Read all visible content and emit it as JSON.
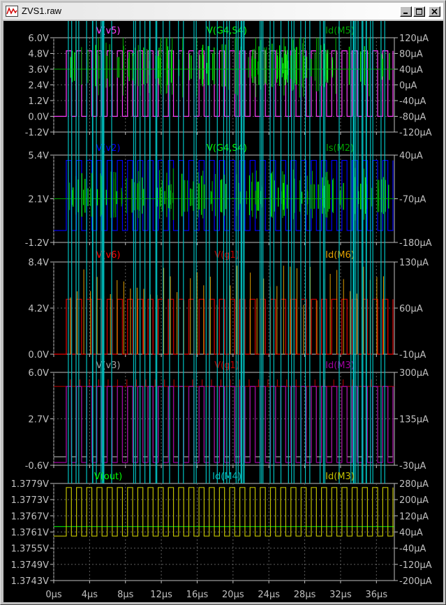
{
  "window": {
    "title": "ZVS1.raw",
    "buttons": {
      "minimize": "minimize-icon",
      "maximize": "maximize-icon",
      "close": "close-icon"
    }
  },
  "colors": {
    "background": "#000000",
    "grid": "#606060",
    "axis_text": "#c0c0c0",
    "magenta": "#ff40ff",
    "green": "#00ff00",
    "dark_green": "#00a000",
    "blue": "#0000ff",
    "red": "#ff0000",
    "dark_red": "#c00000",
    "orange": "#e0a000",
    "gray": "#a0a0a0",
    "purple": "#a000a0",
    "cyan": "#00c0c0",
    "yellow": "#c0c000"
  },
  "chart_data": [
    {
      "type": "line",
      "panel": 1,
      "legend": [
        {
          "label": "V(v5)",
          "color": "#ff40ff"
        },
        {
          "label": "V(G4,S4)",
          "color": "#00ff00"
        },
        {
          "label": "Id(M5)",
          "color": "#00a000"
        }
      ],
      "left_axis": {
        "ticks": [
          "6.0V",
          "4.8V",
          "3.6V",
          "2.4V",
          "1.2V",
          "0.0V",
          "-1.2V"
        ],
        "ylim": [
          -1.2,
          6.0
        ]
      },
      "right_axis": {
        "ticks": [
          "120µA",
          "80µA",
          "40µA",
          "0µA",
          "-40µA",
          "-80µA",
          "-120µA"
        ],
        "ylim": [
          -120,
          120
        ]
      },
      "series": [
        {
          "name": "V(v5)",
          "kind": "square",
          "low": 0.0,
          "high": 5.0,
          "periods": 32
        },
        {
          "name": "V(G4,S4)",
          "kind": "spiky",
          "base": 3.6,
          "amplitude": 1.5
        },
        {
          "name": "Id(M5)",
          "kind": "spiky",
          "base": 40,
          "amplitude": 80
        }
      ]
    },
    {
      "type": "line",
      "panel": 2,
      "legend": [
        {
          "label": "V(v2)",
          "color": "#0000ff"
        },
        {
          "label": "V(G4,S4)",
          "color": "#00ff00"
        },
        {
          "label": "Is(M2)",
          "color": "#00a000"
        }
      ],
      "left_axis": {
        "ticks": [
          "5.4V",
          "2.1V",
          "-1.2V"
        ],
        "ylim": [
          -1.2,
          5.4
        ]
      },
      "right_axis": {
        "ticks": [
          "40µA",
          "-70µA",
          "-180µA"
        ],
        "ylim": [
          -180,
          40
        ]
      },
      "series": [
        {
          "name": "V(v2)",
          "kind": "square",
          "low": -0.3,
          "high": 5.0,
          "periods": 32
        },
        {
          "name": "V(G4,S4)",
          "kind": "spiky",
          "base": 2.1,
          "amplitude": 1.5
        },
        {
          "name": "Is(M2)",
          "kind": "spiky",
          "base": -70,
          "amplitude": 60
        }
      ]
    },
    {
      "type": "line",
      "panel": 3,
      "legend": [
        {
          "label": "V(v6)",
          "color": "#ff0000"
        },
        {
          "label": "V(g1)",
          "color": "#c00000"
        },
        {
          "label": "Id(M6)",
          "color": "#e0a000"
        }
      ],
      "left_axis": {
        "ticks": [
          "8.4V",
          "4.2V",
          "0.0V"
        ],
        "ylim": [
          0.0,
          8.4
        ]
      },
      "right_axis": {
        "ticks": [
          "130µA",
          "60µA",
          "-10µA"
        ],
        "ylim": [
          -10,
          130
        ]
      },
      "series": [
        {
          "name": "V(v6)",
          "kind": "square",
          "low": 0.0,
          "high": 5.0,
          "periods": 32
        },
        {
          "name": "V(g1)",
          "kind": "square",
          "low": 0.0,
          "high": 5.0,
          "periods": 32
        },
        {
          "name": "Id(M6)",
          "kind": "pulses",
          "base": -10,
          "peak": 125,
          "count": 48
        }
      ]
    },
    {
      "type": "line",
      "panel": 4,
      "legend": [
        {
          "label": "V(v3)",
          "color": "#a0a0a0"
        },
        {
          "label": "V(g1)",
          "color": "#c00000"
        },
        {
          "label": "Id(M3)",
          "color": "#a000a0"
        }
      ],
      "left_axis": {
        "ticks": [
          "6.0V",
          "2.7V",
          "-0.6V"
        ],
        "ylim": [
          -0.6,
          6.0
        ]
      },
      "right_axis": {
        "ticks": [
          "300µA",
          "135µA",
          "-30µA"
        ],
        "ylim": [
          -30,
          300
        ]
      },
      "series": [
        {
          "name": "V(v3)",
          "kind": "square",
          "low": 0.0,
          "high": 5.0,
          "periods": 32
        },
        {
          "name": "V(g1)",
          "kind": "flat",
          "value": 5.0
        },
        {
          "name": "Id(M3)",
          "kind": "square",
          "low": -20,
          "high": 250,
          "periods": 32
        }
      ]
    },
    {
      "type": "line",
      "panel": 5,
      "legend": [
        {
          "label": "V(out)",
          "color": "#00ff00"
        },
        {
          "label": "Id(M4)",
          "color": "#00c0c0"
        },
        {
          "label": "Id(M3)",
          "color": "#c0c000"
        }
      ],
      "left_axis": {
        "ticks": [
          "1.3779V",
          "1.3773V",
          "1.3767V",
          "1.3761V",
          "1.3755V",
          "1.3749V",
          "1.3743V"
        ],
        "ylim": [
          1.3743,
          1.3779
        ]
      },
      "right_axis": {
        "ticks": [
          "280µA",
          "200µA",
          "120µA",
          "40µA",
          "-40µA",
          "-120µA",
          "-200µA"
        ],
        "ylim": [
          -200,
          280
        ]
      },
      "x_axis": {
        "ticks": [
          "0µs",
          "4µs",
          "8µs",
          "12µs",
          "16µs",
          "20µs",
          "24µs",
          "28µs",
          "32µs",
          "36µs"
        ],
        "xlim": [
          0,
          38
        ]
      },
      "series": [
        {
          "name": "V(out)",
          "kind": "flat",
          "value": 1.3763
        },
        {
          "name": "Id(M4)",
          "kind": "spiky",
          "base": 120,
          "amplitude": 60
        },
        {
          "name": "Id(M3)",
          "kind": "square",
          "low": 20,
          "high": 260,
          "periods": 32
        }
      ]
    }
  ]
}
